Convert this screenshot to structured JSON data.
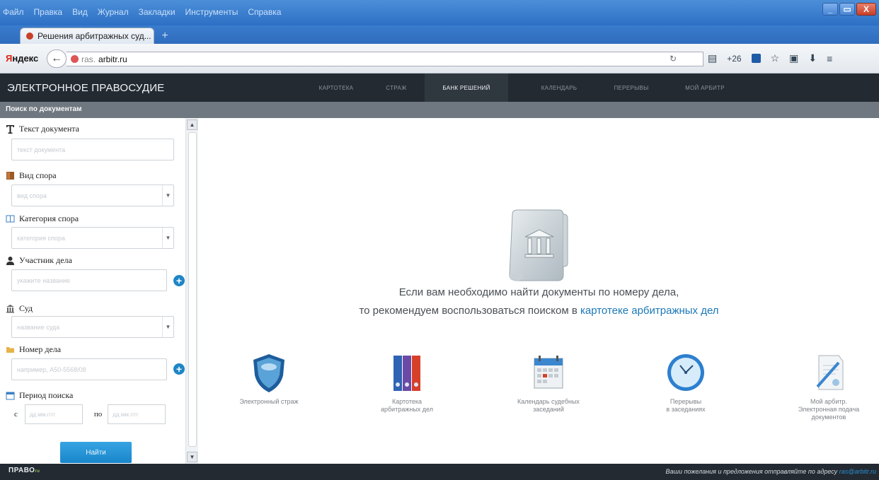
{
  "browser": {
    "menu": [
      "Файл",
      "Правка",
      "Вид",
      "Журнал",
      "Закладки",
      "Инструменты",
      "Справка"
    ],
    "tab_title": "Решения арбитражных суд...",
    "new_tab": "+",
    "yandex_logo": "Яндекс",
    "url_prefix": "ras.",
    "url_domain": "arbitr.ru",
    "extension_count": "+26",
    "window_min": "_",
    "window_max": "▭",
    "window_close": "X"
  },
  "site": {
    "brand": "ЭЛЕКТРОННОЕ ПРАВОСУДИЕ",
    "nav": [
      {
        "label": "КАРТОТЕКА",
        "active": false
      },
      {
        "label": "СТРАЖ",
        "active": false
      },
      {
        "label": "БАНК РЕШЕНИЙ",
        "active": true
      },
      {
        "label": "КАЛЕНДАРЬ",
        "active": false
      },
      {
        "label": "ПЕРЕРЫВЫ",
        "active": false
      },
      {
        "label": "МОЙ АРБИТР",
        "active": false
      }
    ],
    "subheader": "Поиск по документам"
  },
  "search": {
    "text_label": "Текст документа",
    "text_placeholder": "текст документа",
    "dispute_type_label": "Вид спора",
    "dispute_type_placeholder": "вид спора",
    "category_label": "Категория спора",
    "category_placeholder": "категория спора",
    "participant_label": "Участник дела",
    "participant_placeholder": "укажите название",
    "court_label": "Суд",
    "court_placeholder": "название суда",
    "case_number_label": "Номер дела",
    "case_number_placeholder": "например, А50-5568/08",
    "period_label": "Период поиска",
    "from_label": "с",
    "to_label": "по",
    "date_placeholder": "дд.мм.гггг",
    "find_button": "Найти",
    "select_arrow": "▼"
  },
  "main": {
    "message_line1": "Если вам необходимо найти документы по номеру дела,",
    "message_line2_prefix": "то рекомендуем воспользоваться поиском в",
    "message_link": "картотеке арбитражных дел",
    "tiles": [
      {
        "line1": "Электронный страж",
        "line2": "",
        "line3": ""
      },
      {
        "line1": "Картотека",
        "line2": "арбитражных дел",
        "line3": ""
      },
      {
        "line1": "Календарь судебных",
        "line2": "заседаний",
        "line3": ""
      },
      {
        "line1": "Перерывы",
        "line2": "в заседаниях",
        "line3": ""
      },
      {
        "line1": "Мой арбитр.",
        "line2": "Электронная подача",
        "line3": "документов"
      }
    ]
  },
  "footer": {
    "logo": "ПРАВО",
    "logo_sup": "ru",
    "note": "Ваши пожелания и предложения отправляйте по адресу",
    "mail": "ras@arbitr.ru"
  }
}
